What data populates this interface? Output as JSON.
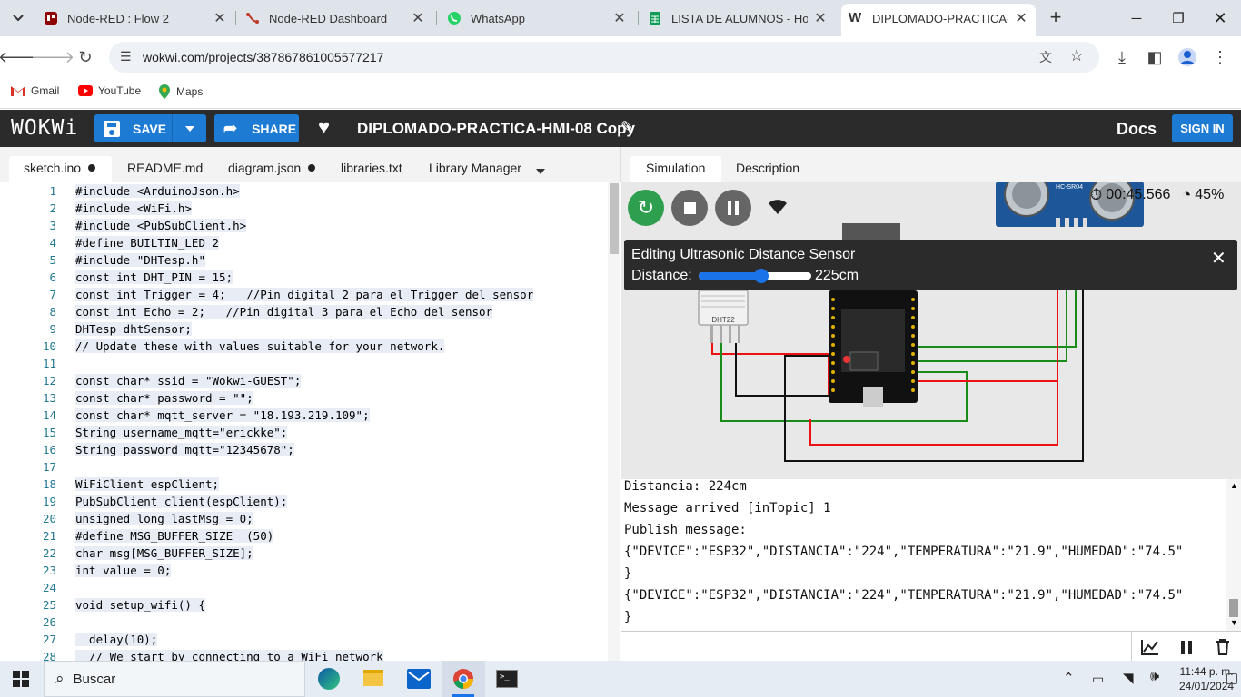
{
  "browser": {
    "tabs": [
      {
        "title": "Node-RED : Flow 2",
        "icon": "node-red-icon"
      },
      {
        "title": "Node-RED Dashboard",
        "icon": "node-red-icon"
      },
      {
        "title": "WhatsApp",
        "icon": "whatsapp-icon"
      },
      {
        "title": "LISTA DE ALUMNOS - Hojas",
        "icon": "sheets-icon"
      },
      {
        "title": "DIPLOMADO-PRACTICA-HMI",
        "icon": "wokwi-icon"
      }
    ],
    "url": "wokwi.com/projects/387867861005577217",
    "bookmarks": [
      "Gmail",
      "YouTube",
      "Maps"
    ]
  },
  "wokwi": {
    "logo": "WOKWi",
    "save_label": "SAVE",
    "share_label": "SHARE",
    "project_title": "DIPLOMADO-PRACTICA-HMI-08 Copy",
    "docs_label": "Docs",
    "signin_label": "SIGN IN"
  },
  "editor": {
    "tabs": [
      "sketch.ino",
      "README.md",
      "diagram.json",
      "libraries.txt",
      "Library Manager"
    ],
    "lines": [
      "#include <ArduinoJson.h>",
      "#include <WiFi.h>",
      "#include <PubSubClient.h>",
      "#define BUILTIN_LED 2",
      "#include \"DHTesp.h\"",
      "const int DHT_PIN = 15;",
      "const int Trigger = 4;   //Pin digital 2 para el Trigger del sensor",
      "const int Echo = 2;   //Pin digital 3 para el Echo del sensor",
      "DHTesp dhtSensor;",
      "// Update these with values suitable for your network.",
      "",
      "const char* ssid = \"Wokwi-GUEST\";",
      "const char* password = \"\";",
      "const char* mqtt_server = \"18.193.219.109\";",
      "String username_mqtt=\"erickke\";",
      "String password_mqtt=\"12345678\";",
      "",
      "WiFiClient espClient;",
      "PubSubClient client(espClient);",
      "unsigned long lastMsg = 0;",
      "#define MSG_BUFFER_SIZE  (50)",
      "char msg[MSG_BUFFER_SIZE];",
      "int value = 0;",
      "",
      "void setup_wifi() {",
      "",
      "  delay(10);",
      "  // We start by connecting to a WiFi network"
    ]
  },
  "simulation": {
    "tabs": [
      "Simulation",
      "Description"
    ],
    "timer": "00:45.566",
    "speed": "45%",
    "editing_title": "Editing Ultrasonic Distance Sensor",
    "distance_label": "Distance:",
    "distance_value": "225cm",
    "distance_fraction": 0.56,
    "dht_label": "DHT22",
    "hcsr_label": "HC-SR04"
  },
  "serial": {
    "lines": [
      "Distancia: 224cm",
      "Message arrived [inTopic] 1",
      "Publish message:",
      "{\"DEVICE\":\"ESP32\",\"DISTANCIA\":\"224\",\"TEMPERATURA\":\"21.9\",\"HUMEDAD\":\"74.5\"",
      "}",
      "{\"DEVICE\":\"ESP32\",\"DISTANCIA\":\"224\",\"TEMPERATURA\":\"21.9\",\"HUMEDAD\":\"74.5\"",
      "}"
    ]
  },
  "taskbar": {
    "search_label": "Buscar",
    "time": "11:44 p. m.",
    "date": "24/01/2024"
  },
  "colors": {
    "wokwi_header": "#2b2b2b",
    "wokwi_blue": "#1d7bd4",
    "wire_green": "#1a8c1a",
    "wire_red": "#e11",
    "wire_black": "#111"
  }
}
